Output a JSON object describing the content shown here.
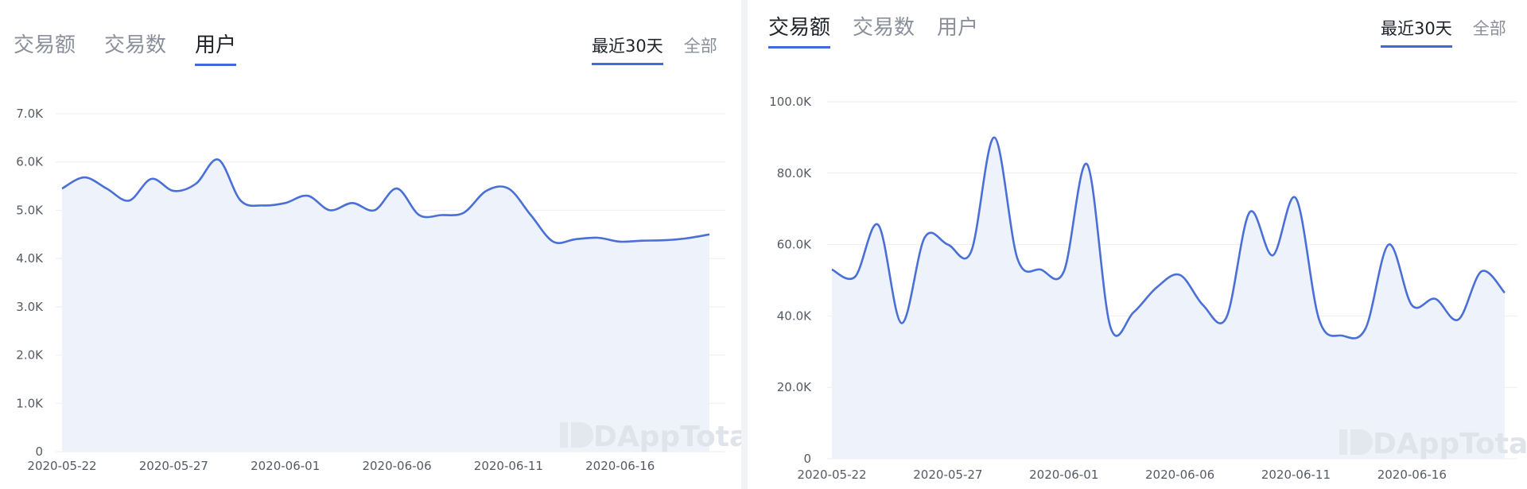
{
  "panels": [
    {
      "tabs": [
        "交易额",
        "交易数",
        "用户"
      ],
      "active_tab": 2,
      "ranges": [
        "最近30天",
        "全部"
      ],
      "active_range": 0,
      "watermark": "DAppTotal"
    },
    {
      "tabs": [
        "交易额",
        "交易数",
        "用户"
      ],
      "active_tab": 0,
      "ranges": [
        "最近30天",
        "全部"
      ],
      "active_range": 0,
      "watermark": "DAppTotal"
    }
  ],
  "colors": {
    "line": "#4a6fd6",
    "fill": "#eef2fb",
    "grid": "#eceef2",
    "accent": "#3f6ad8"
  },
  "chart_data": [
    {
      "type": "area",
      "x": [
        "2020-05-22",
        "2020-05-23",
        "2020-05-24",
        "2020-05-25",
        "2020-05-26",
        "2020-05-27",
        "2020-05-28",
        "2020-05-29",
        "2020-05-30",
        "2020-05-31",
        "2020-06-01",
        "2020-06-02",
        "2020-06-03",
        "2020-06-04",
        "2020-06-05",
        "2020-06-06",
        "2020-06-07",
        "2020-06-08",
        "2020-06-09",
        "2020-06-10",
        "2020-06-11",
        "2020-06-12",
        "2020-06-13",
        "2020-06-14",
        "2020-06-15",
        "2020-06-16",
        "2020-06-17",
        "2020-06-18",
        "2020-06-19",
        "2020-06-20"
      ],
      "values": [
        5450,
        5680,
        5450,
        5200,
        5650,
        5400,
        5550,
        6050,
        5200,
        5100,
        5150,
        5300,
        5000,
        5150,
        5000,
        5450,
        4900,
        4900,
        4950,
        5400,
        5450,
        4900,
        4350,
        4400,
        4430,
        4350,
        4370,
        4380,
        4420,
        4500
      ],
      "xticks": [
        "2020-05-22",
        "2020-05-27",
        "2020-06-01",
        "2020-06-06",
        "2020-06-11",
        "2020-06-16"
      ],
      "yticks": [
        "0",
        "1.0K",
        "2.0K",
        "3.0K",
        "4.0K",
        "5.0K",
        "6.0K",
        "7.0K"
      ],
      "ylim": [
        0,
        7000
      ],
      "grid": true
    },
    {
      "type": "area",
      "x": [
        "2020-05-22",
        "2020-05-23",
        "2020-05-24",
        "2020-05-25",
        "2020-05-26",
        "2020-05-27",
        "2020-05-28",
        "2020-05-29",
        "2020-05-30",
        "2020-05-31",
        "2020-06-01",
        "2020-06-02",
        "2020-06-03",
        "2020-06-04",
        "2020-06-05",
        "2020-06-06",
        "2020-06-07",
        "2020-06-08",
        "2020-06-09",
        "2020-06-10",
        "2020-06-11",
        "2020-06-12",
        "2020-06-13",
        "2020-06-14",
        "2020-06-15",
        "2020-06-16",
        "2020-06-17",
        "2020-06-18",
        "2020-06-19",
        "2020-06-20"
      ],
      "values": [
        53000,
        51000,
        65500,
        38000,
        62000,
        60000,
        58000,
        90000,
        56000,
        53000,
        52500,
        82500,
        37000,
        41000,
        48000,
        51500,
        43000,
        39500,
        69000,
        57000,
        73000,
        39000,
        34500,
        36500,
        60000,
        43000,
        44800,
        39000,
        52500,
        46500
      ],
      "xticks": [
        "2020-05-22",
        "2020-05-27",
        "2020-06-01",
        "2020-06-06",
        "2020-06-11",
        "2020-06-16"
      ],
      "yticks": [
        "0",
        "20.0K",
        "40.0K",
        "60.0K",
        "80.0K",
        "100.0K"
      ],
      "ylim": [
        0,
        100000
      ],
      "grid": true
    }
  ]
}
